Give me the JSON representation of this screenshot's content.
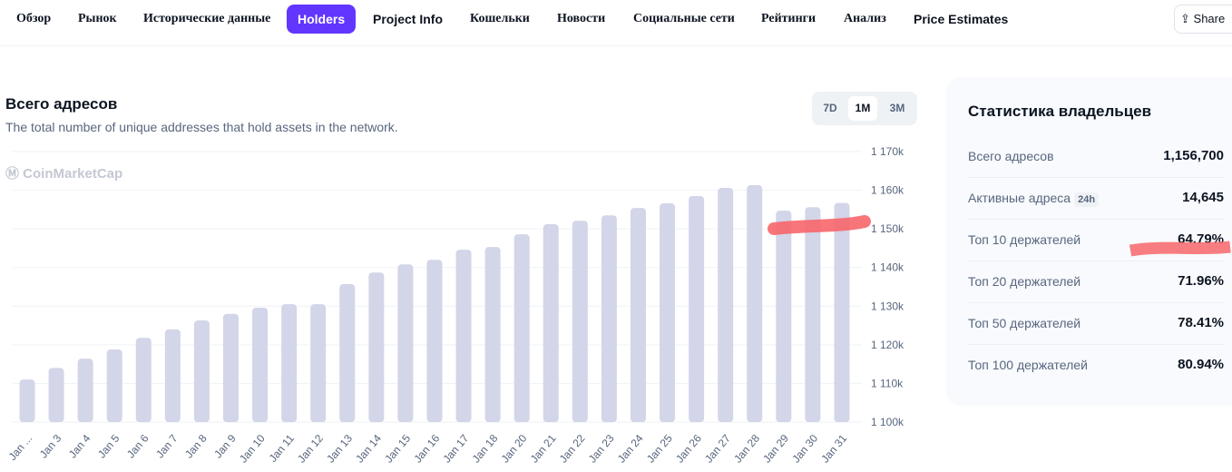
{
  "nav": {
    "tabs": [
      {
        "label": "Обзор",
        "style": "serif"
      },
      {
        "label": "Рынок",
        "style": "serif"
      },
      {
        "label": "Исторические данные",
        "style": "serif"
      },
      {
        "label": "Holders",
        "style": "sans",
        "active": true
      },
      {
        "label": "Project Info",
        "style": "sans"
      },
      {
        "label": "Кошельки",
        "style": "serif"
      },
      {
        "label": "Новости",
        "style": "serif"
      },
      {
        "label": "Социальные сети",
        "style": "serif"
      },
      {
        "label": "Рейтинги",
        "style": "serif"
      },
      {
        "label": "Анализ",
        "style": "serif"
      },
      {
        "label": "Price Estimates",
        "style": "sans"
      }
    ],
    "share_label": "Share"
  },
  "chart_section": {
    "title": "Всего адресов",
    "subtitle": "The total number of unique addresses that hold assets in the network.",
    "ranges": [
      "7D",
      "1M",
      "3M"
    ],
    "active_range": "1M",
    "watermark": "CoinMarketCap"
  },
  "chart_data": {
    "type": "bar",
    "title": "Всего адресов",
    "categories": [
      "Jan ...",
      "Jan 3",
      "Jan 4",
      "Jan 5",
      "Jan 6",
      "Jan 7",
      "Jan 8",
      "Jan 9",
      "Jan 10",
      "Jan 11",
      "Jan 12",
      "Jan 13",
      "Jan 14",
      "Jan 15",
      "Jan 16",
      "Jan 17",
      "Jan 18",
      "Jan 20",
      "Jan 21",
      "Jan 22",
      "Jan 23",
      "Jan 24",
      "Jan 25",
      "Jan 26",
      "Jan 27",
      "Jan 28",
      "Jan 29",
      "Jan 30",
      "Jan 31"
    ],
    "values": [
      1111000,
      1114000,
      1116400,
      1118800,
      1121800,
      1124000,
      1126300,
      1128000,
      1129600,
      1130500,
      1130500,
      1135700,
      1138700,
      1140800,
      1142000,
      1144600,
      1145300,
      1148600,
      1151200,
      1152100,
      1153500,
      1155400,
      1156600,
      1158500,
      1160600,
      1161300,
      1154700,
      1155600,
      1156700
    ],
    "ylim": [
      1100000,
      1170000
    ],
    "yticks": [
      "1 170k",
      "1 160k",
      "1 150k",
      "1 140k",
      "1 130k",
      "1 120k",
      "1 110k",
      "1 100k"
    ],
    "bar_color": "#d3d5e8",
    "grid": true
  },
  "stats": {
    "title": "Статистика владельцев",
    "rows": [
      {
        "label": "Всего адресов",
        "value": "1,156,700"
      },
      {
        "label": "Активные адреса",
        "badge": "24h",
        "value": "14,645"
      },
      {
        "label": "Топ 10 держателей",
        "value": "64.79%"
      },
      {
        "label": "Топ 20 держателей",
        "value": "71.96%"
      },
      {
        "label": "Топ 50 держателей",
        "value": "78.41%"
      },
      {
        "label": "Топ 100 держателей",
        "value": "80.94%"
      }
    ]
  },
  "colors": {
    "accent": "#6236ff",
    "annotation": "#f7666b"
  }
}
